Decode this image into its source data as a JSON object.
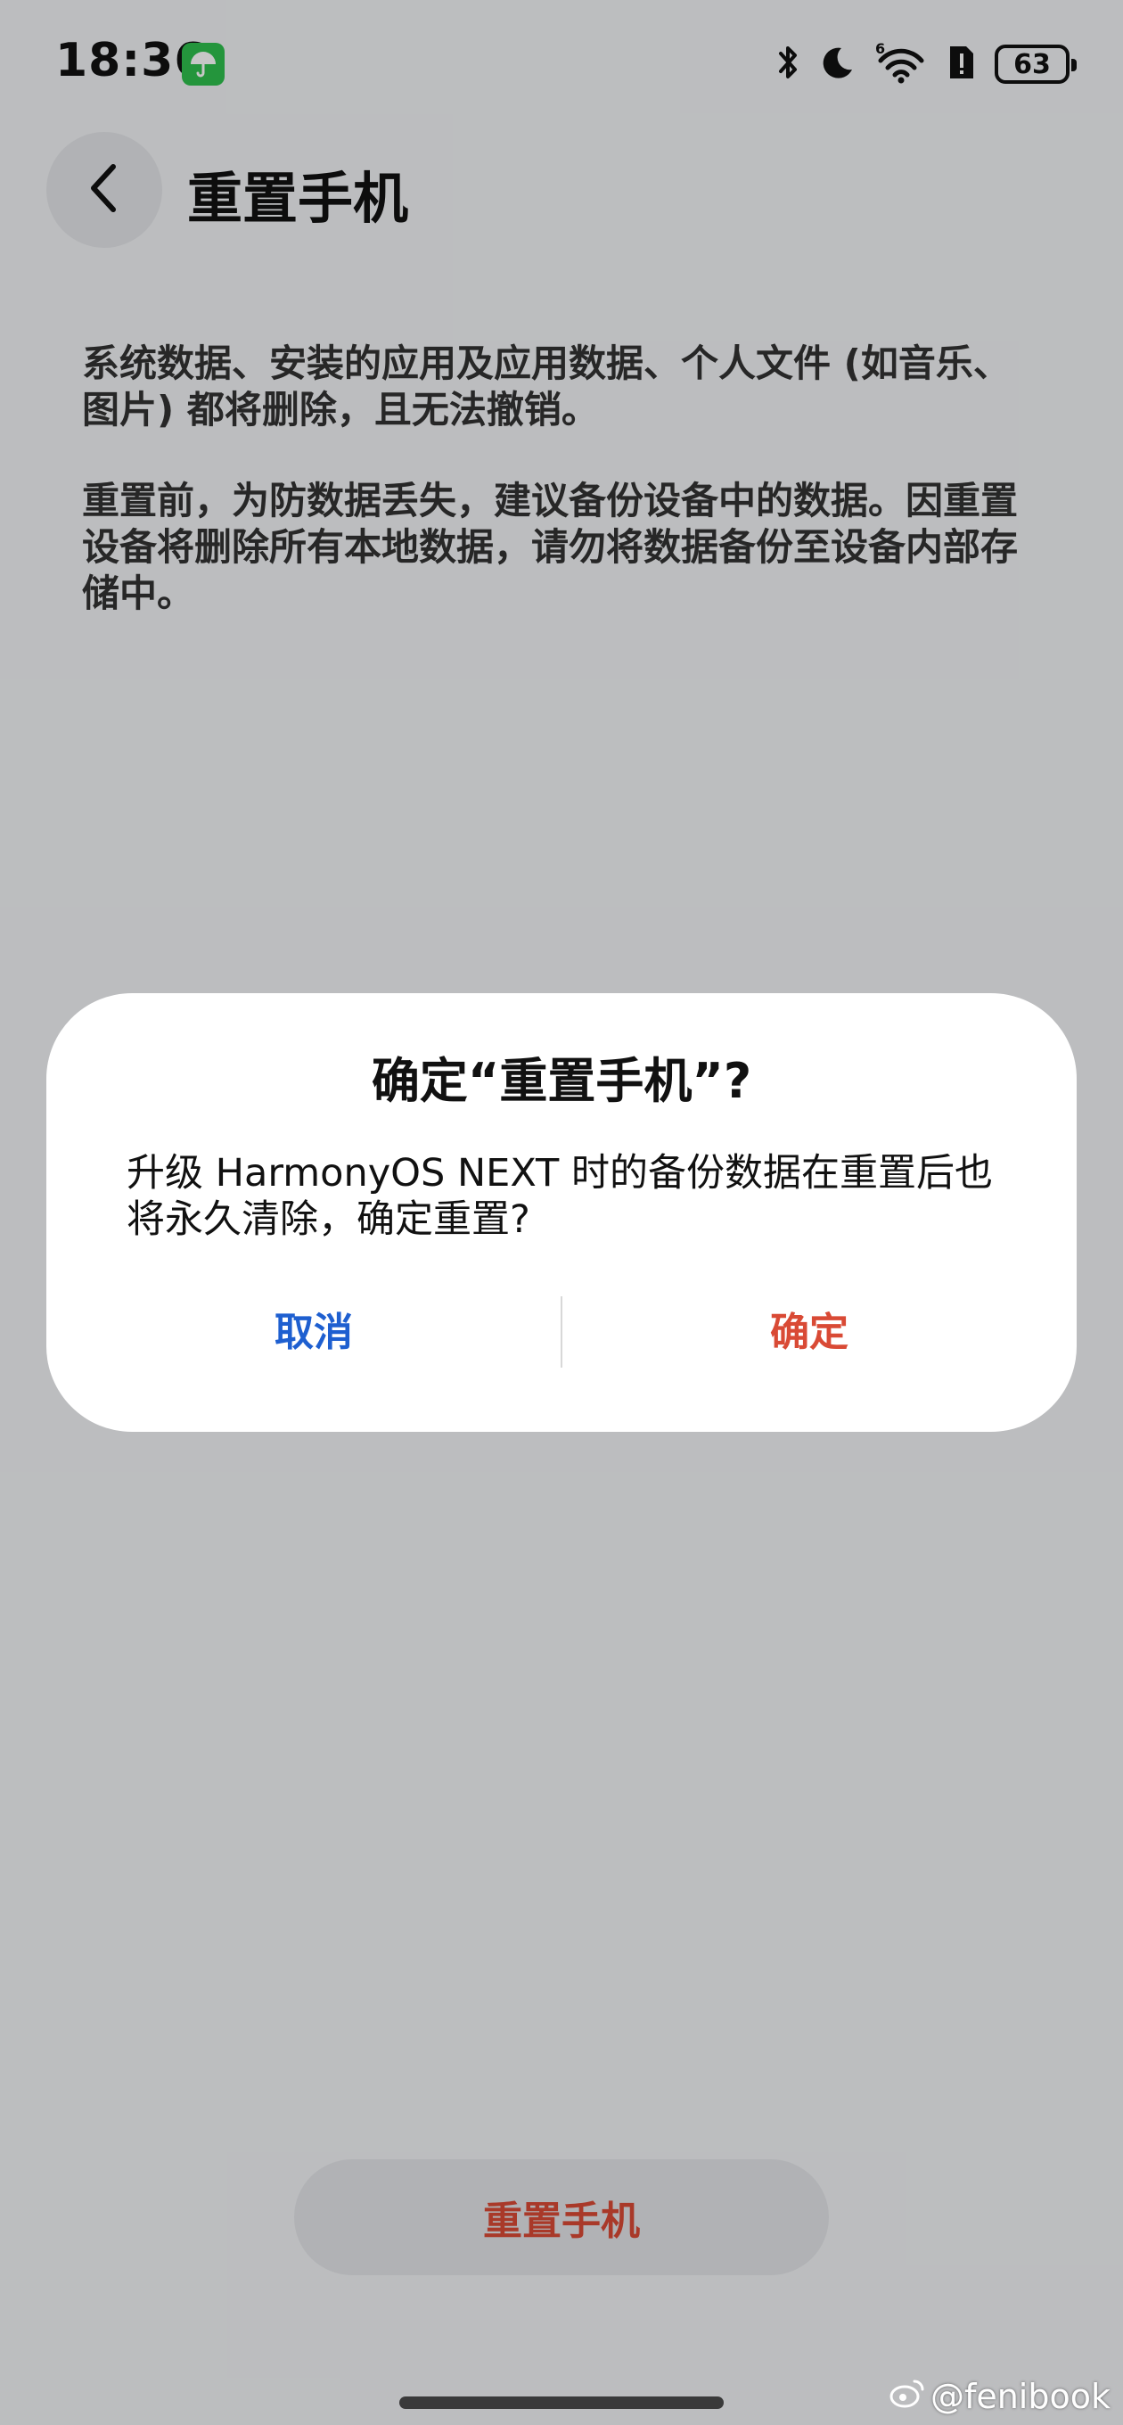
{
  "status_bar": {
    "time": "18:36",
    "battery": "63",
    "icons": [
      "umbrella-icon",
      "bluetooth-icon",
      "moon-icon",
      "wifi-6-icon",
      "alert-sim-icon",
      "battery-icon"
    ]
  },
  "header": {
    "title": "重置手机"
  },
  "body": {
    "paragraph1": "系统数据、安装的应用及应用数据、个人文件 (如音乐、图片) 都将删除，且无法撤销。",
    "paragraph2": "重置前，为防数据丢失，建议备份设备中的数据。因重置设备将删除所有本地数据，请勿将数据备份至设备内部存储中。"
  },
  "dialog": {
    "title": "确定“重置手机”?",
    "message": "升级 HarmonyOS NEXT 时的备份数据在重置后也将永久清除，确定重置?",
    "cancel_label": "取消",
    "confirm_label": "确定"
  },
  "footer": {
    "reset_label": "重置手机"
  },
  "watermark": "@fenibook",
  "colors": {
    "accent_blue": "#1e5fd0",
    "danger_red": "#d94a35",
    "umbrella_green": "#2fbf4d"
  }
}
